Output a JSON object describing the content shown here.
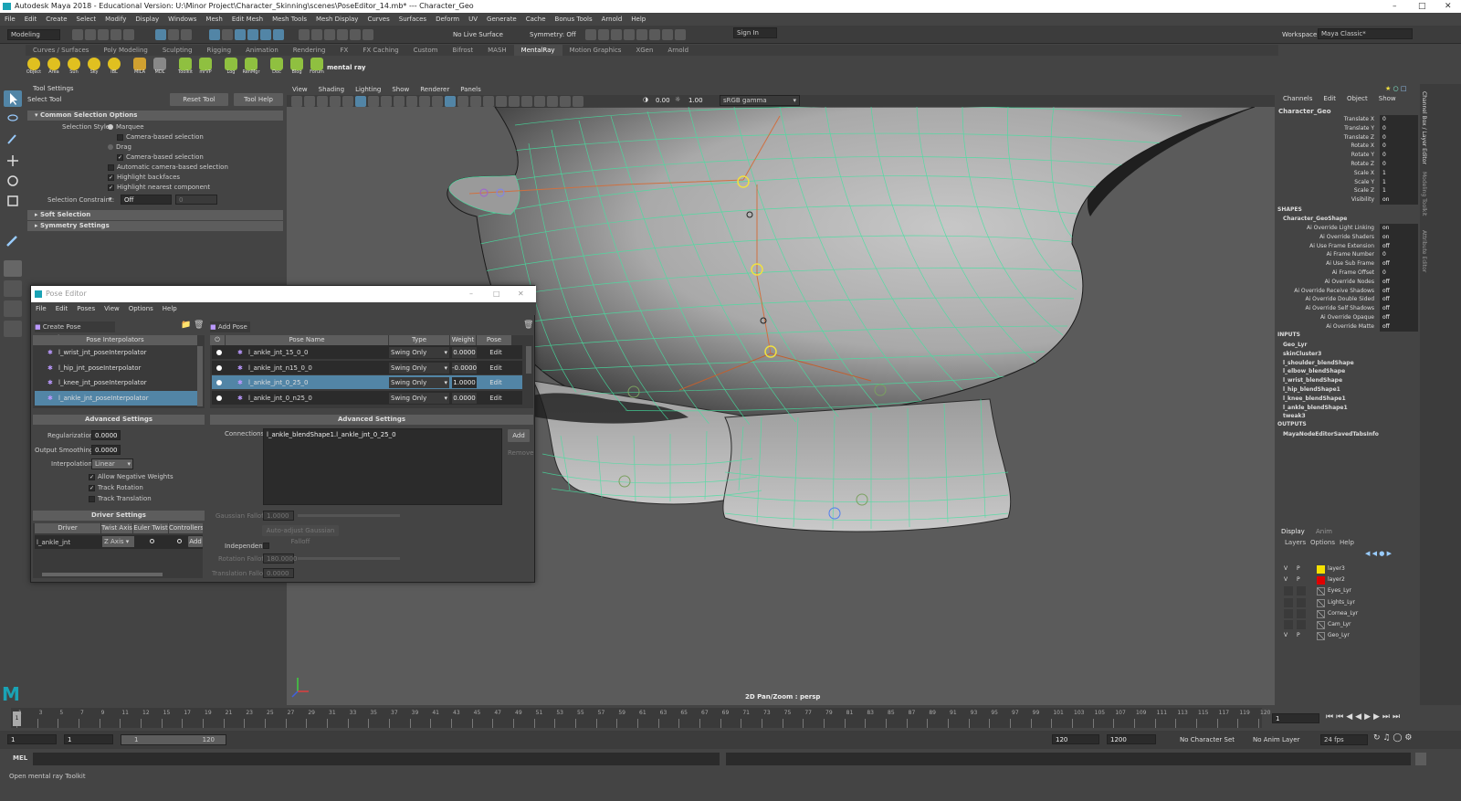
{
  "window": {
    "title": "Autodesk Maya 2018 - Educational Version: U:\\Minor Project\\Character_Skinning\\scenes\\PoseEditor_14.mb*   ---   Character_Geo"
  },
  "menus": [
    "File",
    "Edit",
    "Create",
    "Select",
    "Modify",
    "Display",
    "Windows",
    "Mesh",
    "Edit Mesh",
    "Mesh Tools",
    "Mesh Display",
    "Curves",
    "Surfaces",
    "Deform",
    "UV",
    "Generate",
    "Cache",
    "Bonus Tools",
    "Arnold",
    "Help"
  ],
  "workspace": {
    "label": "Workspace :",
    "value": "Maya Classic*"
  },
  "statusline": {
    "mode": "Modeling",
    "live_surface": "No Live Surface",
    "symmetry": "Symmetry: Off",
    "sign_in": "Sign In"
  },
  "shelf_tabs": [
    "Curves / Surfaces",
    "Poly Modeling",
    "Sculpting",
    "Rigging",
    "Animation",
    "Rendering",
    "FX",
    "FX Caching",
    "Custom",
    "Bifrost",
    "MASH",
    "MentalRay",
    "Motion Graphics",
    "XGen",
    "Arnold"
  ],
  "shelf_active": "MentalRay",
  "shelf_icons": [
    "Object",
    "Area",
    "Sun",
    "Sky",
    "IBL",
    "MILA",
    "MDL",
    "Toolkit",
    "mrVP",
    "Log",
    "RenMgr",
    "Doc",
    "Blog",
    "Forum"
  ],
  "shelf_brand": "mental ray",
  "tool_settings": {
    "panel_title": "Tool Settings",
    "tool": "Select Tool",
    "reset": "Reset Tool",
    "help": "Tool Help",
    "section1": "Common Selection Options",
    "style_label": "Selection Style:",
    "marquee": "Marquee",
    "camera_based1": "Camera-based selection",
    "drag": "Drag",
    "camera_based2": "Camera-based selection",
    "auto_camera": "Automatic camera-based selection",
    "backfaces": "Highlight backfaces",
    "nearest": "Highlight nearest component",
    "constraint_label": "Selection Constraint:",
    "constraint_value": "Off",
    "constraint_num": "0",
    "soft": "Soft Selection",
    "symmetry": "Symmetry Settings"
  },
  "viewport": {
    "menus": [
      "View",
      "Shading",
      "Lighting",
      "Show",
      "Renderer",
      "Panels"
    ],
    "exposure": "0.00",
    "gamma": "1.00",
    "colorspace": "sRGB gamma",
    "hud": "2D Pan/Zoom : persp"
  },
  "channel_box": {
    "tabs": [
      "Channels",
      "Edit",
      "Object",
      "Show"
    ],
    "object": "Character_Geo",
    "attrs": [
      {
        "k": "Translate X",
        "v": "0"
      },
      {
        "k": "Translate Y",
        "v": "0"
      },
      {
        "k": "Translate Z",
        "v": "0"
      },
      {
        "k": "Rotate X",
        "v": "0"
      },
      {
        "k": "Rotate Y",
        "v": "0"
      },
      {
        "k": "Rotate Z",
        "v": "0"
      },
      {
        "k": "Scale X",
        "v": "1"
      },
      {
        "k": "Scale Y",
        "v": "1"
      },
      {
        "k": "Scale Z",
        "v": "1"
      },
      {
        "k": "Visibility",
        "v": "on"
      }
    ],
    "shapes_label": "SHAPES",
    "shape": "Character_GeoShape",
    "shape_attrs": [
      {
        "k": "Ai Override Light Linking",
        "v": "on"
      },
      {
        "k": "Ai Override Shaders",
        "v": "on"
      },
      {
        "k": "Ai Use Frame Extension",
        "v": "off"
      },
      {
        "k": "Ai Frame Number",
        "v": "0"
      },
      {
        "k": "Ai Use Sub Frame",
        "v": "off"
      },
      {
        "k": "Ai Frame Offset",
        "v": "0"
      },
      {
        "k": "Ai Override Nodes",
        "v": "off"
      },
      {
        "k": "Ai Override Receive Shadows",
        "v": "off"
      },
      {
        "k": "Ai Override Double Sided",
        "v": "off"
      },
      {
        "k": "Ai Override Self Shadows",
        "v": "off"
      },
      {
        "k": "Ai Override Opaque",
        "v": "off"
      },
      {
        "k": "Ai Override Matte",
        "v": "off"
      }
    ],
    "inputs_label": "INPUTS",
    "inputs": [
      "Geo_Lyr",
      "skinCluster3",
      "l_shoulder_blendShape",
      "l_elbow_blendShape",
      "l_wrist_blendShape",
      "l_hip_blendShape1",
      "l_knee_blendShape1",
      "l_ankle_blendShape1",
      "tweak3"
    ],
    "outputs_label": "OUTPUTS",
    "outputs": [
      "MayaNodeEditorSavedTabsInfo"
    ]
  },
  "side_tabs": [
    "Channel Box / Layer Editor",
    "Modeling Toolkit",
    "Attribute Editor"
  ],
  "layers": {
    "tabs": [
      "Display",
      "Anim"
    ],
    "menus": [
      "Layers",
      "Options",
      "Help"
    ],
    "items": [
      {
        "v": "V",
        "p": "P",
        "name": "layer3",
        "color": "#f5e100"
      },
      {
        "v": "V",
        "p": "P",
        "name": "layer2",
        "color": "#e00000"
      },
      {
        "v": "",
        "p": "",
        "name": "Eyes_Lyr",
        "color": ""
      },
      {
        "v": "",
        "p": "",
        "name": "Lights_Lyr",
        "color": ""
      },
      {
        "v": "",
        "p": "",
        "name": "Cornea_Lyr",
        "color": ""
      },
      {
        "v": "",
        "p": "",
        "name": "Cam_Lyr",
        "color": ""
      },
      {
        "v": "V",
        "p": "P",
        "name": "Geo_Lyr",
        "color": ""
      }
    ]
  },
  "timeline": {
    "ticks": [
      "1",
      "3",
      "5",
      "7",
      "9",
      "11",
      "12",
      "15",
      "17",
      "19",
      "21",
      "23",
      "25",
      "27",
      "29",
      "31",
      "33",
      "35",
      "37",
      "39",
      "41",
      "43",
      "45",
      "47",
      "49",
      "51",
      "53",
      "55",
      "57",
      "59",
      "61",
      "63",
      "65",
      "67",
      "69",
      "71",
      "73",
      "75",
      "77",
      "79",
      "81",
      "83",
      "85",
      "87",
      "89",
      "91",
      "93",
      "95",
      "97",
      "99",
      "101",
      "103",
      "105",
      "107",
      "109",
      "111",
      "113",
      "115",
      "117",
      "119",
      "120"
    ],
    "current": "1"
  },
  "range": {
    "start": "1",
    "start2": "1",
    "slider_start": "1",
    "slider_end": "120",
    "end": "120",
    "end2": "1200",
    "character": "No Character Set",
    "anim_layer": "No Anim Layer",
    "fps": "24 fps"
  },
  "mel": {
    "label": "MEL"
  },
  "status": {
    "text": "Open mental ray Toolkit"
  },
  "pose_editor": {
    "title": "Pose Editor",
    "menus": [
      "File",
      "Edit",
      "Poses",
      "View",
      "Options",
      "Help"
    ],
    "create_btn": "Create Pose Interpolator",
    "add_pose_btn": "Add Pose",
    "interp_header": "Pose Interpolators",
    "interpolators": [
      "l_wrist_jnt_poseInterpolator",
      "l_hip_jnt_poseInterpolator",
      "l_knee_jnt_poseInterpolator",
      "l_ankle_jnt_poseInterpolator"
    ],
    "pose_cols": [
      "Pose Name",
      "Type",
      "Weight",
      "Pose Shape"
    ],
    "poses": [
      {
        "name": "l_ankle_jnt_15_0_0",
        "type": "Swing Only",
        "weight": "0.0000",
        "shape": "Edit"
      },
      {
        "name": "l_ankle_jnt_n15_0_0",
        "type": "Swing Only",
        "weight": "-0.0000",
        "shape": "Edit"
      },
      {
        "name": "l_ankle_jnt_0_25_0",
        "type": "Swing Only",
        "weight": "1.0000",
        "shape": "Edit"
      },
      {
        "name": "l_ankle_jnt_0_n25_0",
        "type": "Swing Only",
        "weight": "0.0000",
        "shape": "Edit"
      }
    ],
    "adv_left": "Advanced Settings",
    "regularization_label": "Regularization:",
    "regularization": "0.0000",
    "smoothing_label": "Output Smoothing:",
    "smoothing": "0.0000",
    "interp_label": "Interpolation:",
    "interp_value": "Linear",
    "neg_weights": "Allow Negative Weights",
    "track_rot": "Track Rotation",
    "track_trans": "Track Translation",
    "driver_header": "Driver Settings",
    "driver_cols": [
      "Driver",
      "Twist Axis",
      "Euler Twist",
      "Controllers"
    ],
    "driver": "l_ankle_jnt",
    "twist_axis": "Z Axis",
    "add": "Add",
    "adv_right": "Advanced Settings",
    "connections_label": "Connections:",
    "connections": "l_ankle_blendShape1.l_ankle_jnt_0_25_0",
    "conn_add": "Add",
    "conn_remove": "Remove",
    "gauss_label": "Gaussian Falloff:",
    "gauss": "1.0000",
    "auto_adjust": "Auto-adjust Gaussian Falloff",
    "independent": "Independent:",
    "rot_falloff_label": "Rotation Falloff:",
    "rot_falloff": "180.0000",
    "trans_falloff_label": "Translation Falloff:",
    "trans_falloff": "0.0000"
  }
}
